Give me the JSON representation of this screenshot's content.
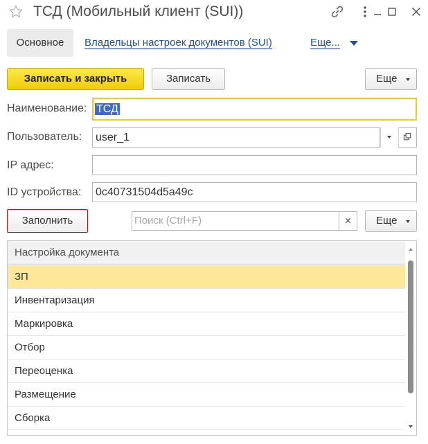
{
  "window": {
    "title": "ТСД (Мобильный клиент (SUI))",
    "icons": [
      "star-icon",
      "link-icon",
      "more-vertical-icon",
      "minimize-icon",
      "maximize-icon",
      "close-icon"
    ]
  },
  "nav": {
    "tabs": [
      {
        "label": "Основное",
        "active": true
      },
      {
        "label": "Владельцы настроек документов (SUI)",
        "active": false
      },
      {
        "label": "Еще...",
        "active": false
      }
    ]
  },
  "toolbar": {
    "save_close_label": "Записать и закрыть",
    "save_label": "Записать",
    "more_label": "Еще"
  },
  "form": {
    "name_label": "Наименование:",
    "name_value": "ТСД",
    "user_label": "Пользователь:",
    "user_value": "user_1",
    "ip_label": "IP адрес:",
    "ip_value": "",
    "device_label": "ID устройства:",
    "device_value": "0c40731504d5a49c"
  },
  "table_toolbar": {
    "fill_label": "Заполнить",
    "search_placeholder": "Поиск (Ctrl+F)",
    "more_label": "Еще"
  },
  "table": {
    "header": "Настройка документа",
    "rows": [
      "ЗП",
      "Инвентаризация",
      "Маркировка",
      "Отбор",
      "Переоценка",
      "Размещение",
      "Сборка"
    ],
    "selected_index": 0
  },
  "colors": {
    "accent_yellow": "#f5c91a",
    "link_blue": "#1f4e9c",
    "selection_row": "#fde89a",
    "fill_button_border": "#a41a1a"
  }
}
